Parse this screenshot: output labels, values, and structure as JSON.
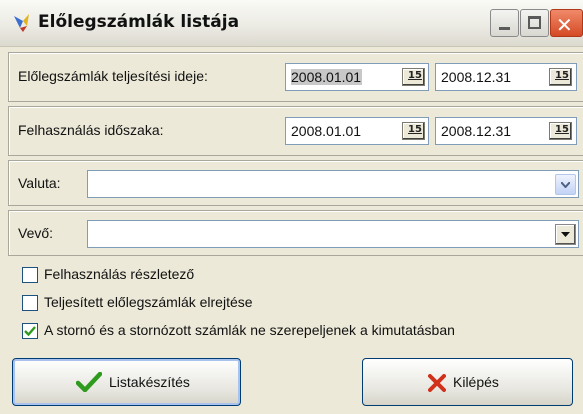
{
  "window": {
    "title": "Előlegszámlák listája",
    "icons": [
      "app-icon",
      "minimize-icon",
      "maximize-icon",
      "close-icon"
    ]
  },
  "teljesites": {
    "label": "Előlegszámlák teljesítési ideje:",
    "from": "2008.01.01",
    "to": "2008.12.31"
  },
  "felhasznalas": {
    "label": "Felhasználás időszaka:",
    "from": "2008.01.01",
    "to": "2008.12.31"
  },
  "valuta": {
    "label": "Valuta:",
    "value": ""
  },
  "vevo": {
    "label": "Vevő:",
    "value": ""
  },
  "calendar_button_text": "15",
  "checkboxes": [
    {
      "label": "Felhasználás részletező",
      "checked": false
    },
    {
      "label": "Teljesített előlegszámlák elrejtése",
      "checked": false
    },
    {
      "label": "A stornó és a stornózott számlák ne szerepeljenek a kimutatásban",
      "checked": true
    }
  ],
  "buttons": {
    "list": "Listakészítés",
    "exit": "Kilépés"
  },
  "colors": {
    "check": "#2e9a1e",
    "exit_x": "#d2301a",
    "border": "#7f9db9"
  }
}
